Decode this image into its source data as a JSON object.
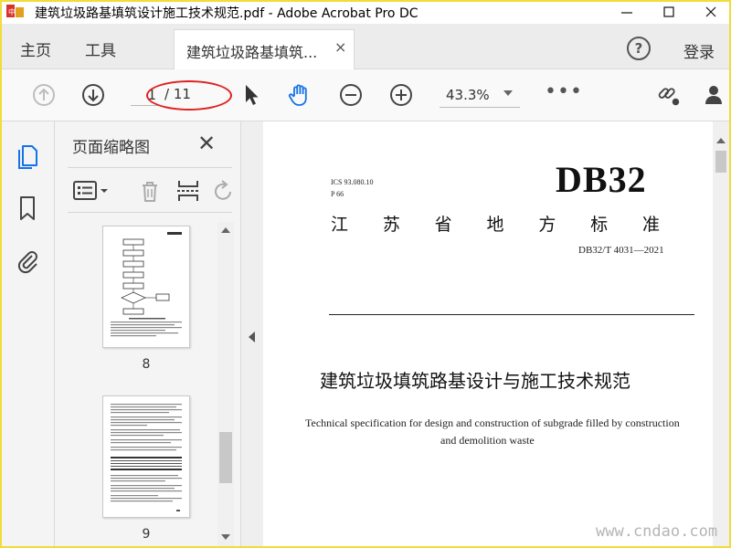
{
  "window": {
    "title": "建筑垃圾路基填筑设计施工技术规范.pdf - Adobe Acrobat Pro DC",
    "frame_color": "#f1dc3a"
  },
  "tabs": {
    "home": "主页",
    "tools": "工具",
    "document": "建筑垃圾路基填筑...",
    "close_glyph": "×",
    "help_glyph": "?",
    "login": "登录"
  },
  "toolbar": {
    "current_page": "1",
    "total_pages": "/ 11",
    "zoom": "43.3%",
    "more": "•••",
    "annotation_color": "#e02020",
    "accent_color": "#1473e6"
  },
  "panel": {
    "title": "页面缩略图",
    "close_glyph": "✕",
    "thumbnails": [
      {
        "label": "8"
      },
      {
        "label": "9"
      }
    ]
  },
  "document": {
    "ics": "ICS  93.080.10",
    "p_code": "P 66",
    "db_code": "DB32",
    "province_chars": [
      "江",
      "苏",
      "省",
      "地",
      "方",
      "标",
      "准"
    ],
    "standard_no": "DB32/T 4031—2021",
    "title_cn": "建筑垃圾填筑路基设计与施工技术规范",
    "title_en_line1": "Technical specification for design and construction of subgrade filled by construction",
    "title_en_line2": "and demolition waste"
  },
  "watermark": "www.cndao.com"
}
